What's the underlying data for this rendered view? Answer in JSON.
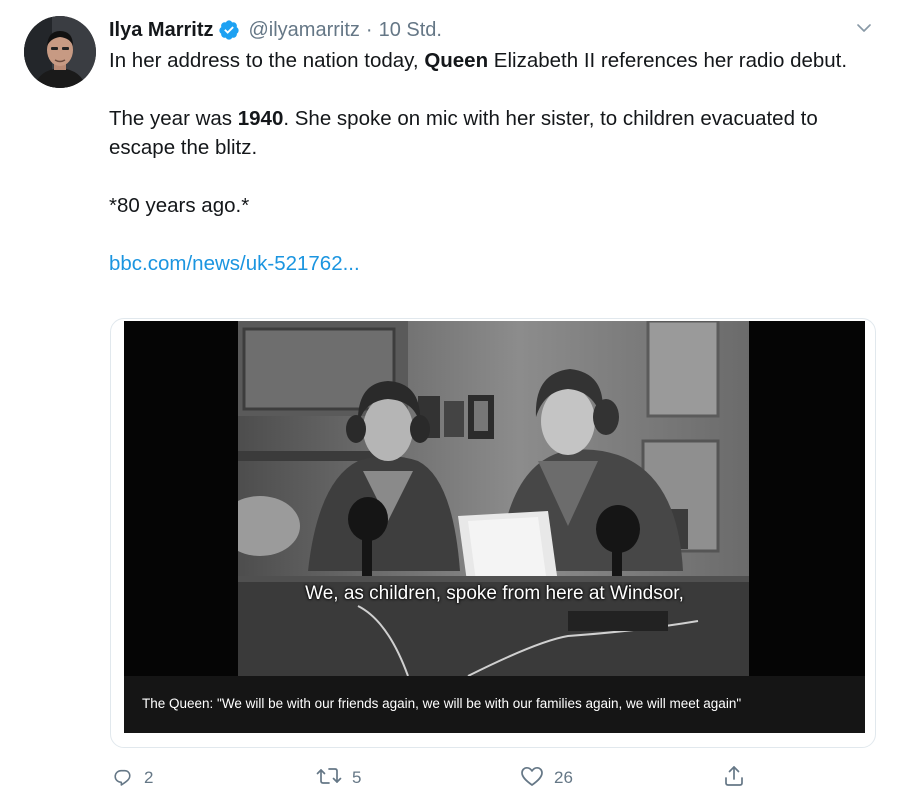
{
  "tweet": {
    "author_name": "Ilya Marritz",
    "handle": "@ilyamarritz",
    "separator": "·",
    "time": "10 Std.",
    "line1_pre": "In her address to the nation today, ",
    "line1_bold": "Queen",
    "line1_post": " Elizabeth II references her radio debut.",
    "line2_pre": "The year was ",
    "line2_bold": "1940",
    "line2_post": ". She spoke on mic with her sister, to children evacuated to escape the blitz.",
    "line3": "*80 years ago.*",
    "link_text": "bbc.com/news/uk-521762..."
  },
  "media": {
    "subtitle": "We, as children, spoke from here at Windsor,",
    "caption": "The Queen: \"We will be with our friends again, we will be with our families again, we will meet again\""
  },
  "actions": {
    "replies": "2",
    "retweets": "5",
    "likes": "26"
  },
  "icons": {
    "verified": "verified-badge-icon",
    "menu": "chevron-down-icon",
    "reply": "reply-icon",
    "retweet": "retweet-icon",
    "like": "heart-icon",
    "share": "share-icon"
  },
  "colors": {
    "accent": "#1da1f2",
    "link": "#1b95e0",
    "secondary_text": "#657786",
    "primary_text": "#14171a"
  }
}
